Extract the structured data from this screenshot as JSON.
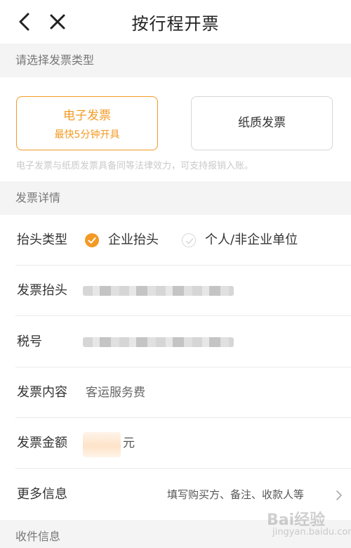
{
  "header": {
    "title": "按行程开票",
    "back_icon": "back-chevron-icon",
    "close_icon": "close-icon"
  },
  "invoice_type": {
    "section_label": "请选择发票类型",
    "options": [
      {
        "label": "电子发票",
        "sub": "最快5分钟开具",
        "selected": true
      },
      {
        "label": "纸质发票",
        "selected": false
      }
    ],
    "note": "电子发票与纸质发票具备同等法律效力，可支持报销入账。",
    "accent_color": "#f39a25"
  },
  "details": {
    "section_label": "发票详情",
    "title_type": {
      "label": "抬头类型",
      "options": [
        {
          "label": "企业抬头",
          "selected": true
        },
        {
          "label": "个人/非企业单位",
          "selected": false
        }
      ]
    },
    "invoice_title": {
      "label": "发票抬头"
    },
    "tax_number": {
      "label": "税号"
    },
    "content": {
      "label": "发票内容",
      "value": "客运服务费"
    },
    "amount": {
      "label": "发票金额",
      "unit": "元"
    },
    "more": {
      "label": "更多信息",
      "hint": "填写购买方、备注、收款人等"
    }
  },
  "receive": {
    "section_label": "收件信息"
  },
  "watermark": {
    "text": "Bai经验",
    "sub": "jingyan.baidu.com"
  }
}
